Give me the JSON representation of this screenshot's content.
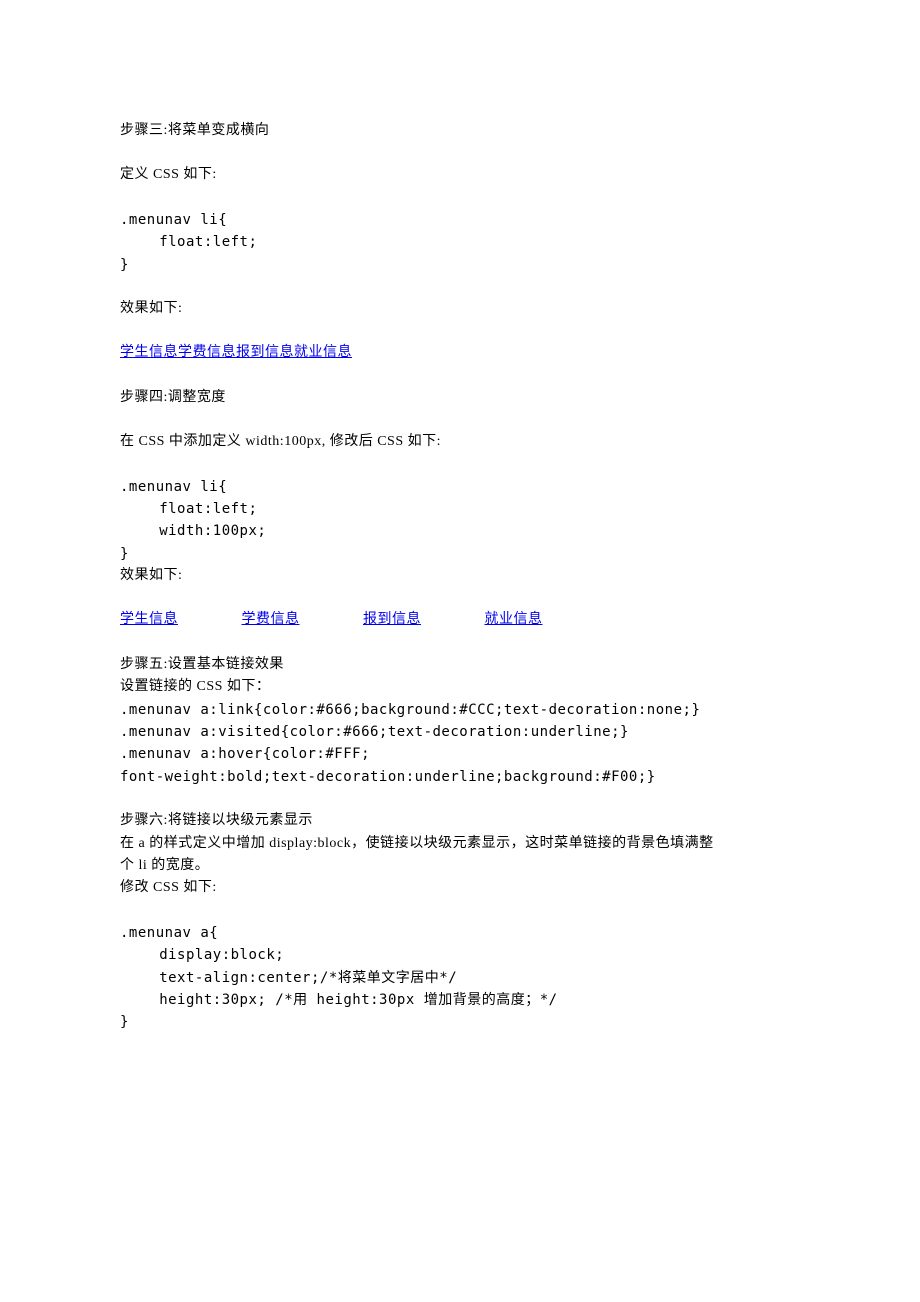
{
  "step3": {
    "title": "步骤三:将菜单变成横向",
    "defLabel": "定义 CSS 如下:",
    "code1": ".menunav li{",
    "code2": "float:left;",
    "code3": "}",
    "resultLabel": "效果如下:",
    "links": {
      "a": "学生信息",
      "b": "学费信息",
      "c": "报到信息",
      "d": "就业信息"
    }
  },
  "step4": {
    "title": "步骤四:调整宽度",
    "intro": "在 CSS 中添加定义 width:100px, 修改后 CSS 如下:",
    "code1": ".menunav li{",
    "code2": "float:left;",
    "code3": "width:100px;",
    "code4": "}",
    "resultLabel": "效果如下:",
    "links": {
      "a": "学生信息",
      "b": "学费信息",
      "c": "报到信息",
      "d": "就业信息"
    }
  },
  "step5": {
    "title": "步骤五:设置基本链接效果",
    "intro": "设置链接的 CSS 如下：",
    "code1": ".menunav a:link{color:#666;background:#CCC;text-decoration:none;}",
    "code2": ".menunav a:visited{color:#666;text-decoration:underline;}",
    "code3": ".menunav a:hover{color:#FFF;",
    "code4": "font-weight:bold;text-decoration:underline;background:#F00;}"
  },
  "step6": {
    "title": "步骤六:将链接以块级元素显示",
    "intro1": "在 a  的样式定义中增加 display:block，使链接以块级元素显示，这时菜单链接的背景色填满整",
    "intro2": "个 li 的宽度。",
    "intro3": "修改 CSS 如下:",
    "code1": ".menunav a{",
    "code2": "display:block;",
    "code3": "text-align:center;/*将菜单文字居中*/",
    "code4": "height:30px; /*用 height:30px 增加背景的高度；*/",
    "code5": "}"
  }
}
